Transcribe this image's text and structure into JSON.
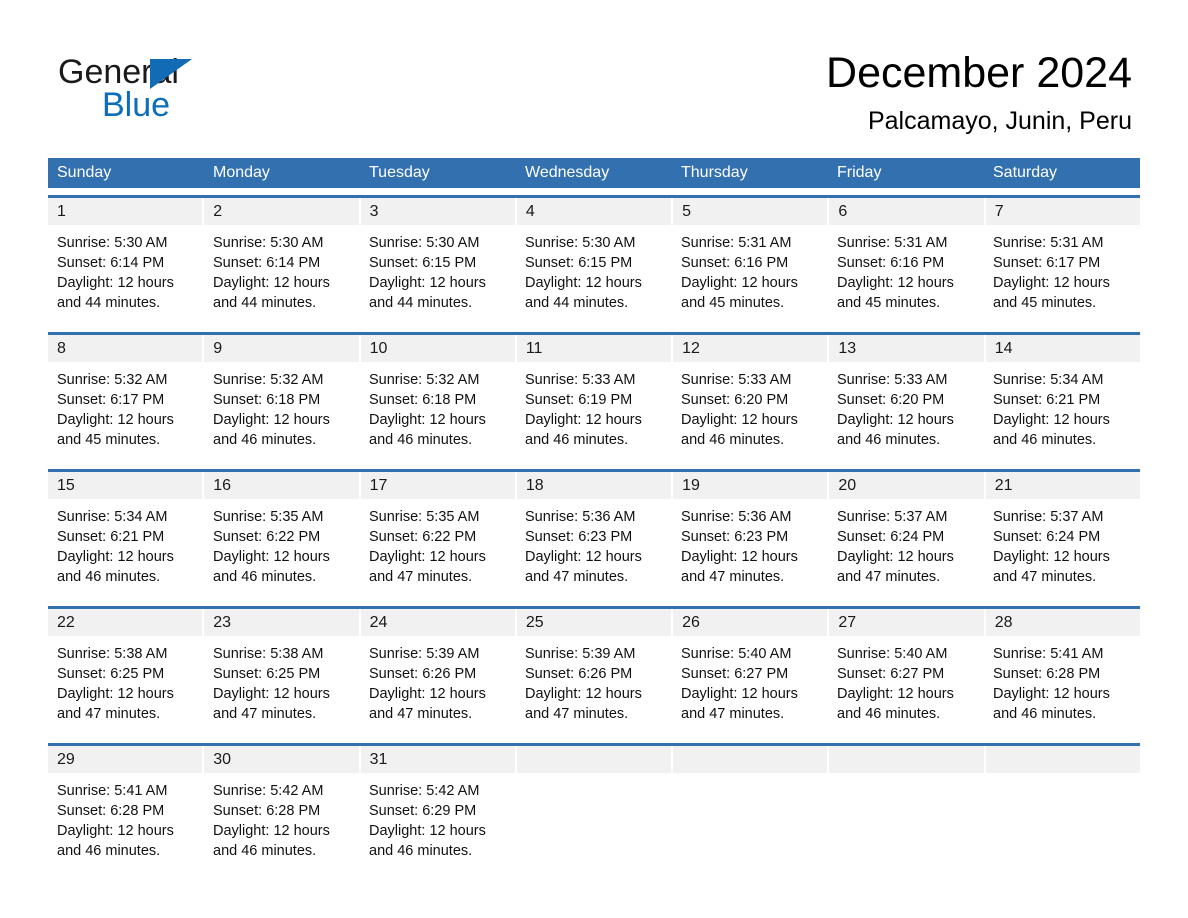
{
  "brand": {
    "name_part1": "General",
    "name_part2": "Blue",
    "triangle_color": "#126cb5",
    "blue_text_color": "#0a6ebd"
  },
  "header": {
    "title": "December 2024",
    "location": "Palcamayo, Junin, Peru"
  },
  "colors": {
    "header_blue": "#3270b0",
    "date_band": "#f1f1f1",
    "week_rule": "#3270b0"
  },
  "weekday_headers": [
    "Sunday",
    "Monday",
    "Tuesday",
    "Wednesday",
    "Thursday",
    "Friday",
    "Saturday"
  ],
  "weeks": [
    {
      "days": [
        {
          "date": "1",
          "sunrise": "Sunrise: 5:30 AM",
          "sunset": "Sunset: 6:14 PM",
          "daylight_line1": "Daylight: 12 hours",
          "daylight_line2": "and 44 minutes."
        },
        {
          "date": "2",
          "sunrise": "Sunrise: 5:30 AM",
          "sunset": "Sunset: 6:14 PM",
          "daylight_line1": "Daylight: 12 hours",
          "daylight_line2": "and 44 minutes."
        },
        {
          "date": "3",
          "sunrise": "Sunrise: 5:30 AM",
          "sunset": "Sunset: 6:15 PM",
          "daylight_line1": "Daylight: 12 hours",
          "daylight_line2": "and 44 minutes."
        },
        {
          "date": "4",
          "sunrise": "Sunrise: 5:30 AM",
          "sunset": "Sunset: 6:15 PM",
          "daylight_line1": "Daylight: 12 hours",
          "daylight_line2": "and 44 minutes."
        },
        {
          "date": "5",
          "sunrise": "Sunrise: 5:31 AM",
          "sunset": "Sunset: 6:16 PM",
          "daylight_line1": "Daylight: 12 hours",
          "daylight_line2": "and 45 minutes."
        },
        {
          "date": "6",
          "sunrise": "Sunrise: 5:31 AM",
          "sunset": "Sunset: 6:16 PM",
          "daylight_line1": "Daylight: 12 hours",
          "daylight_line2": "and 45 minutes."
        },
        {
          "date": "7",
          "sunrise": "Sunrise: 5:31 AM",
          "sunset": "Sunset: 6:17 PM",
          "daylight_line1": "Daylight: 12 hours",
          "daylight_line2": "and 45 minutes."
        }
      ]
    },
    {
      "days": [
        {
          "date": "8",
          "sunrise": "Sunrise: 5:32 AM",
          "sunset": "Sunset: 6:17 PM",
          "daylight_line1": "Daylight: 12 hours",
          "daylight_line2": "and 45 minutes."
        },
        {
          "date": "9",
          "sunrise": "Sunrise: 5:32 AM",
          "sunset": "Sunset: 6:18 PM",
          "daylight_line1": "Daylight: 12 hours",
          "daylight_line2": "and 46 minutes."
        },
        {
          "date": "10",
          "sunrise": "Sunrise: 5:32 AM",
          "sunset": "Sunset: 6:18 PM",
          "daylight_line1": "Daylight: 12 hours",
          "daylight_line2": "and 46 minutes."
        },
        {
          "date": "11",
          "sunrise": "Sunrise: 5:33 AM",
          "sunset": "Sunset: 6:19 PM",
          "daylight_line1": "Daylight: 12 hours",
          "daylight_line2": "and 46 minutes."
        },
        {
          "date": "12",
          "sunrise": "Sunrise: 5:33 AM",
          "sunset": "Sunset: 6:20 PM",
          "daylight_line1": "Daylight: 12 hours",
          "daylight_line2": "and 46 minutes."
        },
        {
          "date": "13",
          "sunrise": "Sunrise: 5:33 AM",
          "sunset": "Sunset: 6:20 PM",
          "daylight_line1": "Daylight: 12 hours",
          "daylight_line2": "and 46 minutes."
        },
        {
          "date": "14",
          "sunrise": "Sunrise: 5:34 AM",
          "sunset": "Sunset: 6:21 PM",
          "daylight_line1": "Daylight: 12 hours",
          "daylight_line2": "and 46 minutes."
        }
      ]
    },
    {
      "days": [
        {
          "date": "15",
          "sunrise": "Sunrise: 5:34 AM",
          "sunset": "Sunset: 6:21 PM",
          "daylight_line1": "Daylight: 12 hours",
          "daylight_line2": "and 46 minutes."
        },
        {
          "date": "16",
          "sunrise": "Sunrise: 5:35 AM",
          "sunset": "Sunset: 6:22 PM",
          "daylight_line1": "Daylight: 12 hours",
          "daylight_line2": "and 46 minutes."
        },
        {
          "date": "17",
          "sunrise": "Sunrise: 5:35 AM",
          "sunset": "Sunset: 6:22 PM",
          "daylight_line1": "Daylight: 12 hours",
          "daylight_line2": "and 47 minutes."
        },
        {
          "date": "18",
          "sunrise": "Sunrise: 5:36 AM",
          "sunset": "Sunset: 6:23 PM",
          "daylight_line1": "Daylight: 12 hours",
          "daylight_line2": "and 47 minutes."
        },
        {
          "date": "19",
          "sunrise": "Sunrise: 5:36 AM",
          "sunset": "Sunset: 6:23 PM",
          "daylight_line1": "Daylight: 12 hours",
          "daylight_line2": "and 47 minutes."
        },
        {
          "date": "20",
          "sunrise": "Sunrise: 5:37 AM",
          "sunset": "Sunset: 6:24 PM",
          "daylight_line1": "Daylight: 12 hours",
          "daylight_line2": "and 47 minutes."
        },
        {
          "date": "21",
          "sunrise": "Sunrise: 5:37 AM",
          "sunset": "Sunset: 6:24 PM",
          "daylight_line1": "Daylight: 12 hours",
          "daylight_line2": "and 47 minutes."
        }
      ]
    },
    {
      "days": [
        {
          "date": "22",
          "sunrise": "Sunrise: 5:38 AM",
          "sunset": "Sunset: 6:25 PM",
          "daylight_line1": "Daylight: 12 hours",
          "daylight_line2": "and 47 minutes."
        },
        {
          "date": "23",
          "sunrise": "Sunrise: 5:38 AM",
          "sunset": "Sunset: 6:25 PM",
          "daylight_line1": "Daylight: 12 hours",
          "daylight_line2": "and 47 minutes."
        },
        {
          "date": "24",
          "sunrise": "Sunrise: 5:39 AM",
          "sunset": "Sunset: 6:26 PM",
          "daylight_line1": "Daylight: 12 hours",
          "daylight_line2": "and 47 minutes."
        },
        {
          "date": "25",
          "sunrise": "Sunrise: 5:39 AM",
          "sunset": "Sunset: 6:26 PM",
          "daylight_line1": "Daylight: 12 hours",
          "daylight_line2": "and 47 minutes."
        },
        {
          "date": "26",
          "sunrise": "Sunrise: 5:40 AM",
          "sunset": "Sunset: 6:27 PM",
          "daylight_line1": "Daylight: 12 hours",
          "daylight_line2": "and 47 minutes."
        },
        {
          "date": "27",
          "sunrise": "Sunrise: 5:40 AM",
          "sunset": "Sunset: 6:27 PM",
          "daylight_line1": "Daylight: 12 hours",
          "daylight_line2": "and 46 minutes."
        },
        {
          "date": "28",
          "sunrise": "Sunrise: 5:41 AM",
          "sunset": "Sunset: 6:28 PM",
          "daylight_line1": "Daylight: 12 hours",
          "daylight_line2": "and 46 minutes."
        }
      ]
    },
    {
      "days": [
        {
          "date": "29",
          "sunrise": "Sunrise: 5:41 AM",
          "sunset": "Sunset: 6:28 PM",
          "daylight_line1": "Daylight: 12 hours",
          "daylight_line2": "and 46 minutes."
        },
        {
          "date": "30",
          "sunrise": "Sunrise: 5:42 AM",
          "sunset": "Sunset: 6:28 PM",
          "daylight_line1": "Daylight: 12 hours",
          "daylight_line2": "and 46 minutes."
        },
        {
          "date": "31",
          "sunrise": "Sunrise: 5:42 AM",
          "sunset": "Sunset: 6:29 PM",
          "daylight_line1": "Daylight: 12 hours",
          "daylight_line2": "and 46 minutes."
        },
        {
          "date": "",
          "sunrise": "",
          "sunset": "",
          "daylight_line1": "",
          "daylight_line2": ""
        },
        {
          "date": "",
          "sunrise": "",
          "sunset": "",
          "daylight_line1": "",
          "daylight_line2": ""
        },
        {
          "date": "",
          "sunrise": "",
          "sunset": "",
          "daylight_line1": "",
          "daylight_line2": ""
        },
        {
          "date": "",
          "sunrise": "",
          "sunset": "",
          "daylight_line1": "",
          "daylight_line2": ""
        }
      ]
    }
  ]
}
